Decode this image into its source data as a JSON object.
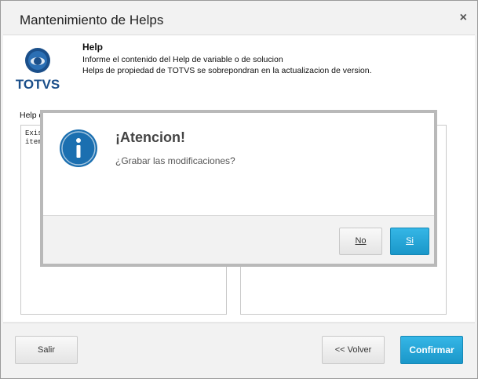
{
  "window": {
    "title": "Mantenimiento de Helps",
    "close_glyph": "×"
  },
  "header": {
    "logo_text": "TOTVS",
    "help_title": "Help",
    "description_line1": "Informe el contenido del Help de variable o de solucion",
    "description_line2": "Helps de propiedad de TOTVS se sobrepondran en la actualizacion de version."
  },
  "body": {
    "help_label": "Help d",
    "left_editor_lines": [
      "Exis",
      "item"
    ]
  },
  "footer": {
    "salir_label": "Salir",
    "volver_label": "<< Volver",
    "confirmar_label": "Confirmar"
  },
  "dialog": {
    "title": "¡Atencion!",
    "message": "¿Grabar las modificaciones?",
    "no_label": "No",
    "si_label": "Si",
    "icon": "info-icon"
  },
  "colors": {
    "accent_blue": "#1a97c9",
    "info_icon_blue": "#1b6fb0",
    "logo_dark_blue": "#1b4f8a"
  }
}
